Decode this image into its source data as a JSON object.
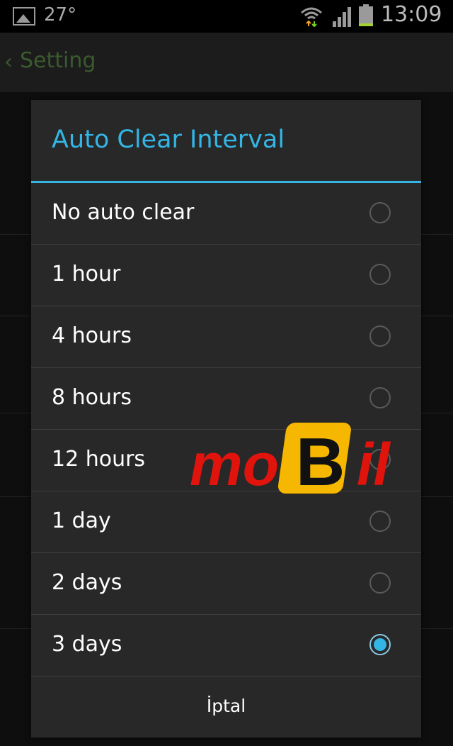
{
  "status_bar": {
    "temperature": "27°",
    "time": "13:09",
    "icons": [
      "gallery-icon",
      "wifi-icon",
      "signal-icon",
      "battery-icon"
    ]
  },
  "action_bar": {
    "back_icon": "chevron-left-icon",
    "title": "Setting"
  },
  "dialog": {
    "title": "Auto Clear Interval",
    "options": [
      {
        "label": "No auto clear",
        "selected": false
      },
      {
        "label": "1 hour",
        "selected": false
      },
      {
        "label": "4 hours",
        "selected": false
      },
      {
        "label": "8 hours",
        "selected": false
      },
      {
        "label": "12 hours",
        "selected": false
      },
      {
        "label": "1 day",
        "selected": false
      },
      {
        "label": "2 days",
        "selected": false
      },
      {
        "label": "3 days",
        "selected": true
      }
    ],
    "cancel_label": "İptal"
  },
  "watermark": {
    "text_left": "mo",
    "badge": "B",
    "text_right": "il"
  },
  "colors": {
    "accent": "#33b5e5",
    "dialog_bg": "#282828",
    "watermark_red": "#e0140c",
    "watermark_yellow": "#f5b700"
  }
}
